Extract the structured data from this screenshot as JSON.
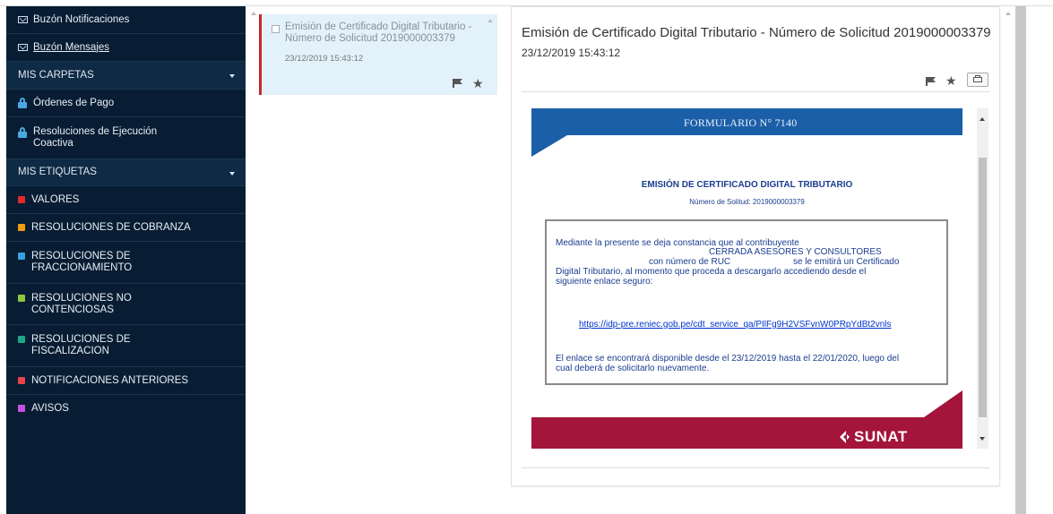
{
  "sidebar": {
    "items": [
      {
        "type": "link",
        "label": "Buzón Notificaciones",
        "icon": "mail-icon"
      },
      {
        "type": "link",
        "label": "Buzón Mensajes",
        "icon": "mail-icon"
      },
      {
        "type": "section",
        "label": "MIS CARPETAS"
      },
      {
        "type": "folder",
        "label": "Órdenes de Pago",
        "icon": "lock-icon"
      },
      {
        "type": "folder",
        "label": "Resoluciones de Ejecución Coactiva",
        "icon": "lock-icon"
      },
      {
        "type": "section",
        "label": "MIS ETIQUETAS"
      },
      {
        "type": "tag",
        "label": "VALORES",
        "color": "#e02a2a"
      },
      {
        "type": "tag",
        "label": "RESOLUCIONES DE COBRANZA",
        "color": "#f39c12"
      },
      {
        "type": "tag",
        "label": "RESOLUCIONES DE FRACCIONAMIENTO",
        "color": "#3aa0e0"
      },
      {
        "type": "tag",
        "label": "RESOLUCIONES NO CONTENCIOSAS",
        "color": "#8cc63f"
      },
      {
        "type": "tag",
        "label": "RESOLUCIONES DE FISCALIZACION",
        "color": "#1fa58a"
      },
      {
        "type": "tag",
        "label": "NOTIFICACIONES ANTERIORES",
        "color": "#e8424a"
      },
      {
        "type": "tag",
        "label": "AVISOS",
        "color": "#c64fe0"
      }
    ]
  },
  "message_list": {
    "items": [
      {
        "title": "Emisión de Certificado Digital Tributario - Número de Solicitud 2019000003379",
        "date": "23/12/2019 15:43:12",
        "flag_icon": "flag-icon",
        "star_icon": "star-icon"
      }
    ]
  },
  "detail": {
    "title": "Emisión de Certificado Digital Tributario - Número de Solicitud 2019000003379",
    "date": "23/12/2019 15:43:12",
    "icons": [
      "flag-icon",
      "star-icon",
      "print-icon"
    ],
    "form": {
      "header": "FORMULARIO N° 7140",
      "title": "EMISIÓN DE CERTIFICADO DIGITAL TRIBUTARIO",
      "request": "Número de Solitud: 2019000003379",
      "body_line1": "Mediante la presente se deja constancia que al contribuyente",
      "body_line2": "CERRADA ASESORES Y CONSULTORES",
      "body_line3": "con número de RUC",
      "body_line3b": "se le emitirá un Certificado",
      "body_line4": "Digital Tributario, al momento que proceda a descargarlo accediendo desde el",
      "body_line5": "siguiente enlace seguro:",
      "link": "https://idp-pre.reniec.gob.pe/cdt_service_qa/PIlFg9H2VSFvnW0PRpYdBt2vnls",
      "avail_line1": "El enlace se encontrará disponible desde el 23/12/2019 hasta el 22/01/2020, luego del",
      "avail_line2": "cual deberá de solicitarlo nuevamente.",
      "footer_logo": "SUNAT"
    }
  },
  "colors": {
    "sidebar_bg": "#081d33",
    "header_blue": "#1b5fa8",
    "footer_red": "#a3153a",
    "selected_item_bg": "#e3f1fb",
    "selected_item_border": "#c9262c"
  }
}
